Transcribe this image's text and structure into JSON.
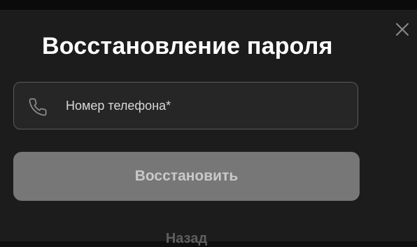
{
  "dialog": {
    "title": "Восстановление пароля",
    "close_icon": "close-icon"
  },
  "phone_field": {
    "icon": "phone-icon",
    "value": "",
    "placeholder": "Номер телефона*"
  },
  "actions": {
    "submit_label": "Восстановить",
    "back_label": "Назад"
  },
  "colors": {
    "page_background": "#0f0f0f",
    "dialog_background": "#1c1c1c",
    "field_background": "#262626",
    "field_border": "#5a5a5a",
    "submit_background": "#777777",
    "submit_text": "#c9c9c9",
    "title_text": "#ffffff",
    "back_text": "#5f5f5f"
  }
}
